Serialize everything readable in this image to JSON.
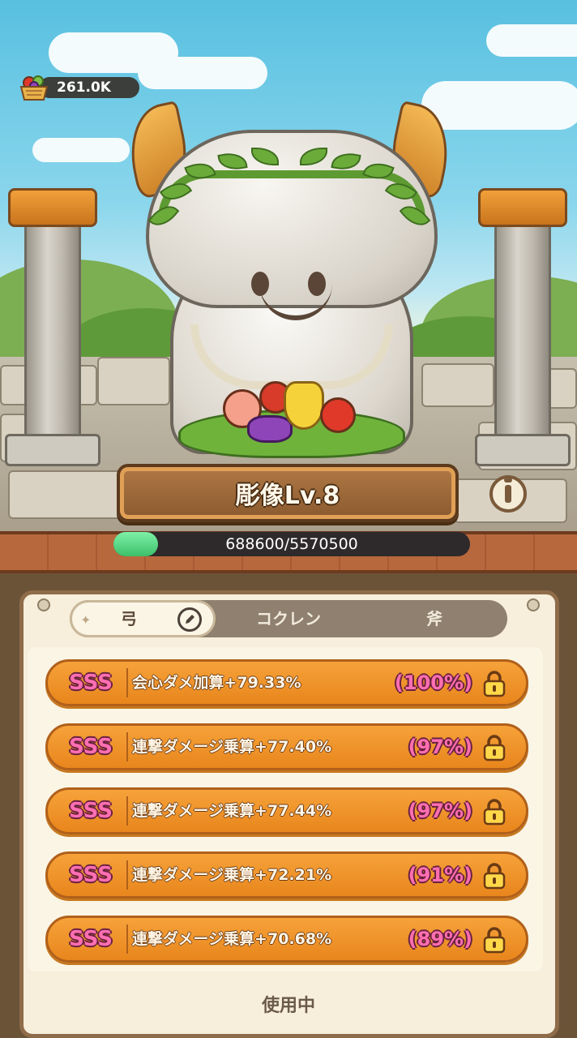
{
  "resource": {
    "icon": "fruit-basket-icon",
    "amount": "261.0K"
  },
  "statue": {
    "title": "彫像Lv.8"
  },
  "progress": {
    "text": "688600/5570500",
    "fraction": 0.124
  },
  "tabs": [
    {
      "label": "弓",
      "active": true,
      "icon": "pencil-icon"
    },
    {
      "label": "コクレン",
      "active": false
    },
    {
      "label": "斧",
      "active": false
    }
  ],
  "stats": [
    {
      "rank": "SSS",
      "text": "会心ダメ加算+79.33%",
      "pct": "(100%)",
      "icon": "lock-icon"
    },
    {
      "rank": "SSS",
      "text": "連撃ダメージ乗算+77.40%",
      "pct": "(97%)",
      "icon": "lock-icon"
    },
    {
      "rank": "SSS",
      "text": "連撃ダメージ乗算+77.44%",
      "pct": "(97%)",
      "icon": "lock-icon"
    },
    {
      "rank": "SSS",
      "text": "連撃ダメージ乗算+72.21%",
      "pct": "(91%)",
      "icon": "lock-icon"
    },
    {
      "rank": "SSS",
      "text": "連撃ダメージ乗算+70.68%",
      "pct": "(89%)",
      "icon": "lock-icon"
    }
  ],
  "status": "使用中",
  "colors": {
    "row": "#f09a2e",
    "rank": "#ff6fb1",
    "progress": "#4fd07e",
    "panel": "#f7eedb"
  }
}
